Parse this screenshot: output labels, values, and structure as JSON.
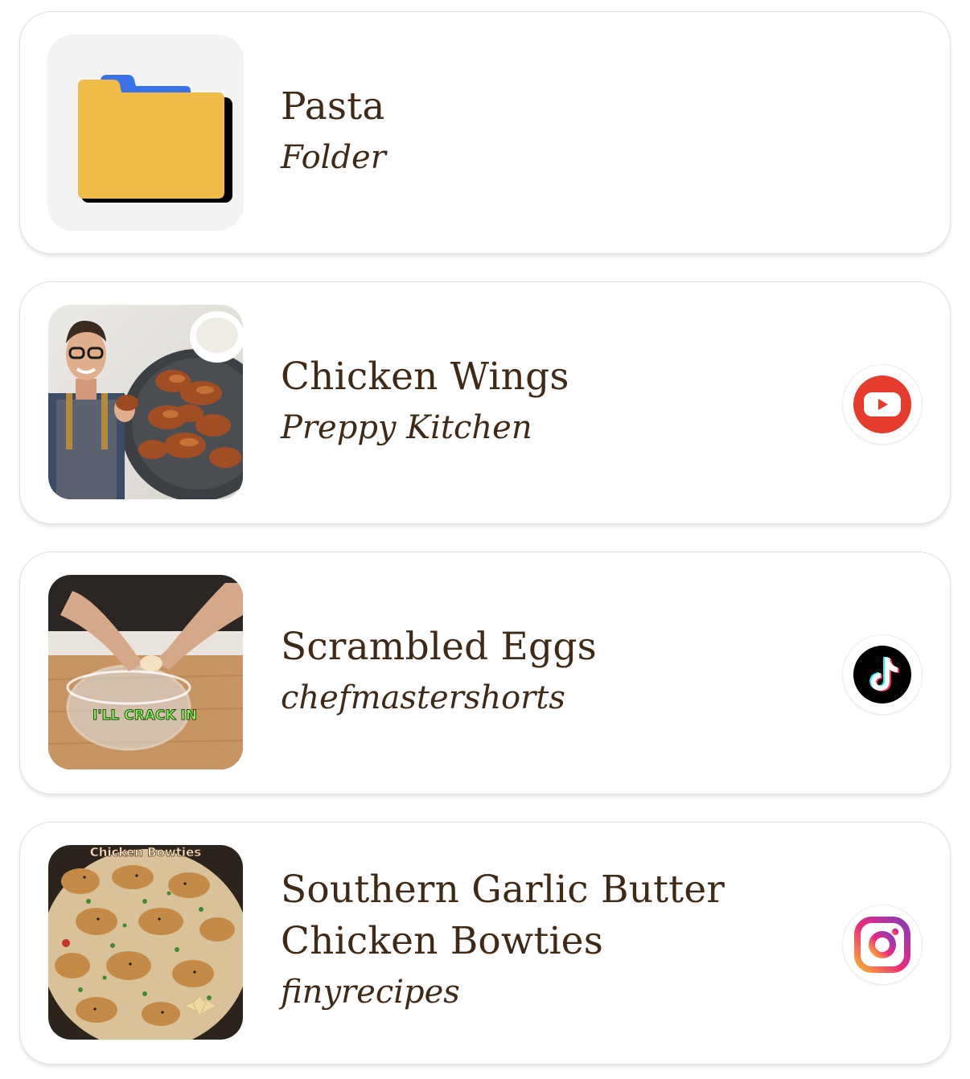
{
  "items": [
    {
      "title": "Pasta",
      "subtitle": "Folder",
      "thumbnail": "folder-icon"
    },
    {
      "title": "Chicken Wings",
      "subtitle": "Preppy Kitchen",
      "thumbnail": "chicken-wings-photo",
      "source": "youtube-icon"
    },
    {
      "title": "Scrambled Eggs",
      "subtitle": "chefmastershorts",
      "thumbnail": "egg-cracking-photo",
      "thumbnail_caption": "I'LL CRACK IN",
      "source": "tiktok-icon"
    },
    {
      "title": "Southern Garlic Butter Chicken Bowties",
      "title_line1": "Southern Garlic Butter",
      "title_line2": "Chicken Bowties",
      "subtitle": "finyrecipes",
      "thumbnail": "chicken-bowties-photo",
      "thumbnail_caption": "Chicken Bowties",
      "source": "instagram-icon"
    }
  ],
  "colors": {
    "text": "#3f2a17",
    "folder_body": "#f0bb47",
    "folder_tab": "#3a73e6",
    "youtube": "#e43b2d",
    "tiktok": "#000000",
    "instagram_start": "#f9b233",
    "instagram_end": "#b23ac7"
  }
}
